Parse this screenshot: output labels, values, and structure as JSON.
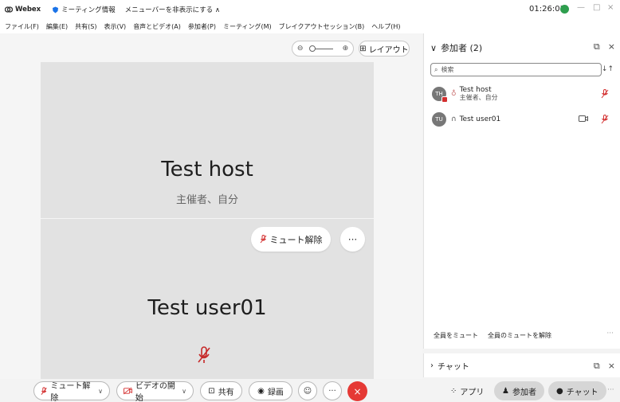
{
  "titlebar": {
    "app_name": "Webex",
    "meeting_info": "ミーティング情報",
    "hide_menu": "メニューバーを非表示にする ∧",
    "clock": "01:26:01",
    "minimize": "—",
    "maximize": "□",
    "close": "×"
  },
  "menu": [
    "ファイル(F)",
    "編集(E)",
    "共有(S)",
    "表示(V)",
    "音声とビデオ(A)",
    "参加者(P)",
    "ミーティング(M)",
    "ブレイクアウトセッション(B)",
    "ヘルプ(H)"
  ],
  "stage": {
    "layout_label": "レイアウト",
    "host": {
      "name": "Test host",
      "role": "主催者、自分"
    },
    "user": {
      "name": "Test user01"
    },
    "unmute_label": "ミュート解除",
    "more_label": "···"
  },
  "participants": {
    "header": "参加者 (2)",
    "search_placeholder": "検索",
    "list": [
      {
        "initials": "TH",
        "name": "Test host",
        "sub": "主催者、自分"
      },
      {
        "initials": "TU",
        "name": "Test user01",
        "sub": ""
      }
    ],
    "mute_all": "全員をミュート",
    "unmute_all": "全員のミュートを解除",
    "more": "···"
  },
  "chat": {
    "label": "チャット"
  },
  "toolbar": {
    "unmute": "ミュート解除",
    "start_video": "ビデオの開始",
    "share": "共有",
    "record": "録画",
    "more": "···",
    "apps": "アプリ",
    "participants": "参加者",
    "chat": "チャット",
    "overflow": "···"
  },
  "colors": {
    "end_call": "#e53935",
    "mute_red": "#d32f2f",
    "status_green": "#2e9e4e"
  }
}
